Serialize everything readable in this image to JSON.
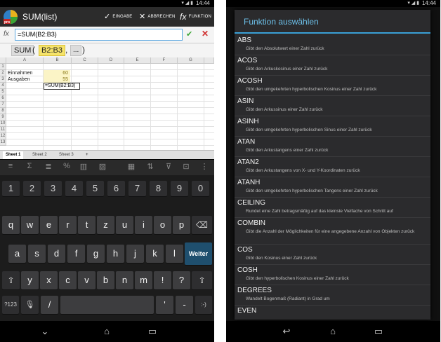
{
  "left": {
    "status": {
      "time": "14:44",
      "icons": "▾ ◢ ▮"
    },
    "actionbar": {
      "title": "SUM(list)",
      "confirm_label": "EINGABE",
      "cancel_label": "ABBRECHEN",
      "function_label": "FUNKTION"
    },
    "formula": {
      "fx": "fx",
      "value": "=SUM(B2:B3)"
    },
    "hint": {
      "name": "SUM",
      "open": "(",
      "arg": "B2:B3",
      "sep": ",",
      "more": "...",
      "close": ")"
    },
    "sheet": {
      "columns": [
        "A",
        "B",
        "C",
        "D",
        "E",
        "F",
        "G"
      ],
      "rows": [
        "1",
        "2",
        "3",
        "4",
        "5",
        "6",
        "7",
        "8",
        "9",
        "10",
        "11",
        "12",
        "13"
      ],
      "cells": {
        "a2": "Einnahmen",
        "b2": "60",
        "a3": "Ausgaben",
        "b3": "55",
        "b4": "=SUM(B2:B3)"
      }
    },
    "tabs": [
      "Sheet 1",
      "Sheet 2",
      "Sheet 3",
      "+"
    ],
    "keyboard": {
      "row1": [
        "1",
        "2",
        "3",
        "4",
        "5",
        "6",
        "7",
        "8",
        "9",
        "0"
      ],
      "row2": [
        "q",
        "w",
        "e",
        "r",
        "t",
        "z",
        "u",
        "i",
        "o",
        "p"
      ],
      "row3": [
        "a",
        "s",
        "d",
        "f",
        "g",
        "h",
        "j",
        "k",
        "l"
      ],
      "row4": [
        "y",
        "x",
        "c",
        "v",
        "b",
        "n",
        "m",
        "!",
        "?"
      ],
      "enter_label": "Weiter",
      "sym_label": "?123",
      "slash": "/",
      "quote": "'",
      "dash": "-",
      "smiley": ":-)"
    }
  },
  "right": {
    "status": {
      "time": "14:44",
      "icons": "▾ ◢ ▮"
    },
    "dialog_title": "Funktion auswählen",
    "functions": [
      {
        "name": "ABS",
        "desc": "Gibt den Absolutwert einer Zahl zurück"
      },
      {
        "name": "ACOS",
        "desc": "Gibt den Arkuskosinus einer Zahl zurück"
      },
      {
        "name": "ACOSH",
        "desc": "Gibt den umgekehrten hyperbolischen Kosinus einer Zahl zurück"
      },
      {
        "name": "ASIN",
        "desc": "Gibt den Arkussinus einer Zahl zurück"
      },
      {
        "name": "ASINH",
        "desc": "Gibt den umgekehrten hyperbolischen Sinus einer Zahl zurück"
      },
      {
        "name": "ATAN",
        "desc": "Gibt den Arkustangens einer Zahl zurück"
      },
      {
        "name": "ATAN2",
        "desc": "Gibt den Arkustangens von X- und Y-Koordinaten zurück"
      },
      {
        "name": "ATANH",
        "desc": "Gibt den umgekehrten hyperbolischen Tangens einer Zahl zurück"
      },
      {
        "name": "CEILING",
        "desc": "Rundet eine Zahl betragsmäßig auf das kleinste Vielfache von Schritt auf"
      },
      {
        "name": "COMBIN",
        "desc": "Gibt die Anzahl der Möglichkeiten für eine angegebene Anzahl von Objekten zurück"
      },
      {
        "name": "COS",
        "desc": "Gibt den Kosinus einer Zahl zurück"
      },
      {
        "name": "COSH",
        "desc": "Gibt den hyperbolischen Kosinus einer Zahl zurück"
      },
      {
        "name": "DEGREES",
        "desc": "Wandelt Bogenmaß (Radiant) in Grad um"
      },
      {
        "name": "EVEN",
        "desc": ""
      }
    ]
  },
  "colors": {
    "accent": "#3aa0d6",
    "highlight": "#f5e36a",
    "ok": "#3aa534",
    "cancel": "#d03030"
  }
}
